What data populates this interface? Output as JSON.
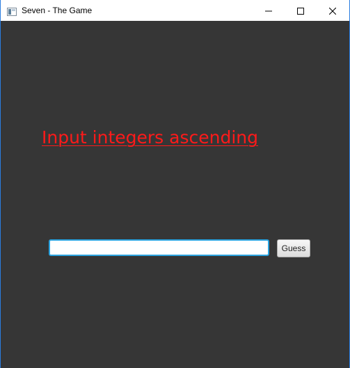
{
  "window": {
    "title": "Seven - The Game",
    "icon": "app-window-icon",
    "controls": {
      "minimize_icon": "minimize-icon",
      "maximize_icon": "maximize-icon",
      "close_icon": "close-icon"
    }
  },
  "main": {
    "prompt_text": "Input integers ascending",
    "prompt_color": "#ff1a1a",
    "background_color": "#363636",
    "input": {
      "value": "",
      "placeholder": ""
    },
    "guess_label": "Guess"
  }
}
